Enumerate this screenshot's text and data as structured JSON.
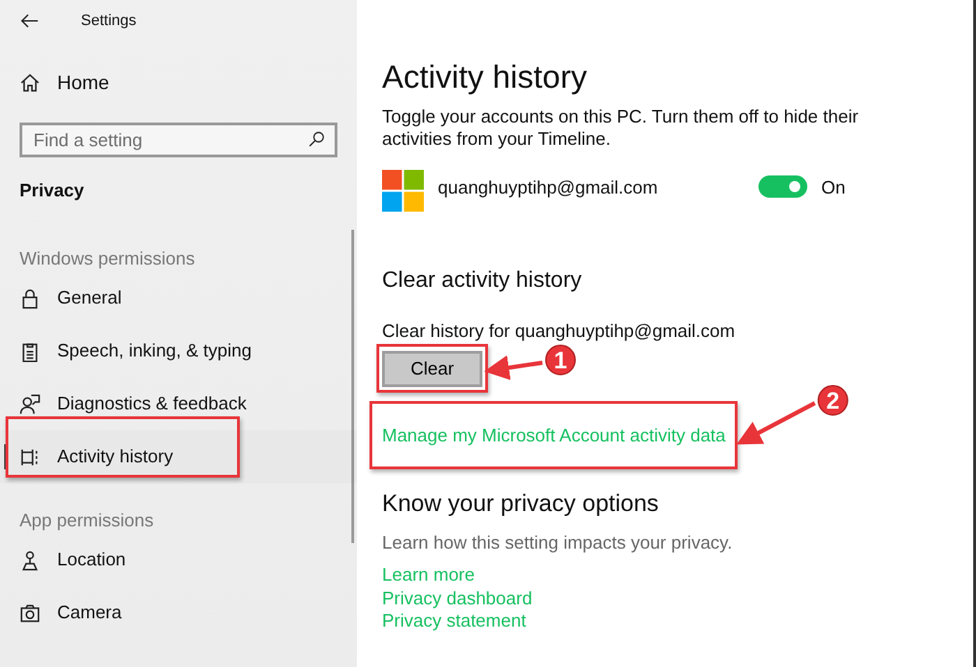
{
  "window": {
    "title": "Settings"
  },
  "sidebar": {
    "home": "Home",
    "search": {
      "placeholder": "Find a setting"
    },
    "section": "Privacy",
    "groups": [
      {
        "heading": "Windows permissions",
        "items": [
          {
            "label": "General",
            "selected": false,
            "framed": false
          },
          {
            "label": "Speech, inking, & typing",
            "selected": false,
            "framed": false
          },
          {
            "label": "Diagnostics & feedback",
            "selected": false,
            "framed": false
          },
          {
            "label": "Activity history",
            "selected": true,
            "framed": true
          }
        ]
      },
      {
        "heading": "App permissions",
        "items": [
          {
            "label": "Location",
            "selected": false,
            "framed": false
          },
          {
            "label": "Camera",
            "selected": false,
            "framed": false
          }
        ]
      }
    ]
  },
  "content": {
    "title": "Activity history",
    "description": "Toggle your accounts on this PC. Turn them off to hide their activities from your Timeline.",
    "account": {
      "email": "quanghuyptihp@gmail.com",
      "on": true,
      "state_label": "On"
    },
    "clear": {
      "heading": "Clear activity history",
      "label": "Clear history for quanghuyptihp@gmail.com",
      "button": "Clear",
      "framed": true,
      "callout": "1"
    },
    "manage_link": {
      "label": "Manage my Microsoft Account activity data",
      "framed": true,
      "callout": "2"
    },
    "privacy": {
      "heading": "Know your privacy options",
      "text": "Learn how this setting impacts your privacy.",
      "links": [
        "Learn more",
        "Privacy dashboard",
        "Privacy statement"
      ]
    }
  }
}
